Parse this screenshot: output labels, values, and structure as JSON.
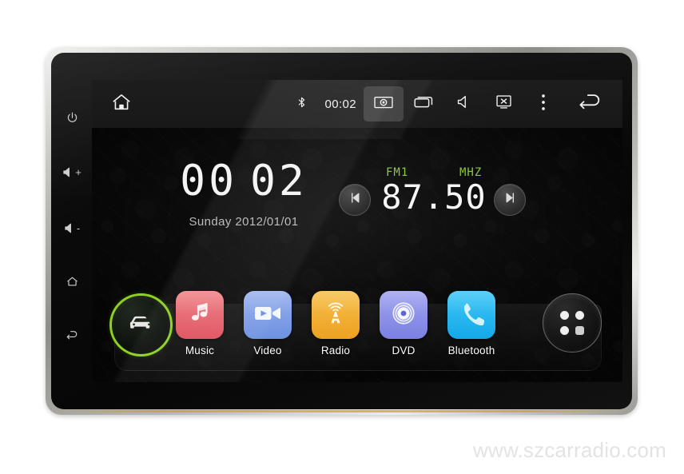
{
  "device": {
    "name": "2-din android car radio head unit",
    "watermark": "www.szcarradio.com"
  },
  "hardware_keys": [
    {
      "name": "power",
      "icon": "power-icon",
      "label": ""
    },
    {
      "name": "volume-up",
      "icon": "volume-up-icon",
      "label": "+"
    },
    {
      "name": "volume-down",
      "icon": "volume-down-icon",
      "label": "-"
    },
    {
      "name": "home",
      "icon": "home-outline-icon",
      "label": ""
    },
    {
      "name": "back",
      "icon": "back-arrow-icon",
      "label": ""
    }
  ],
  "statusbar": {
    "home_icon": "home-icon",
    "bluetooth_icon": "bluetooth-icon",
    "clock": "00:02",
    "screenshot_icon": "screenshot-icon",
    "recents_icon": "recents-icon",
    "volume_icon": "volume-icon",
    "screen_off_icon": "screen-off-icon",
    "overflow_icon": "overflow-menu-icon",
    "back_icon": "back-arrow-icon",
    "active_item": "screenshot"
  },
  "clock_widget": {
    "hours": "00",
    "minutes": "02",
    "date": "Sunday 2012/01/01"
  },
  "radio_widget": {
    "band": "FM1",
    "unit": "MHZ",
    "frequency": "87.50",
    "accent_color": "#8cc63f",
    "prev_icon": "skip-previous-icon",
    "next_icon": "skip-next-icon"
  },
  "dock": {
    "car_button": {
      "label": "",
      "icon": "car-icon",
      "ring_color": "#8ed122"
    },
    "apps": [
      {
        "label": "Music",
        "icon": "music-note-icon",
        "color": "#e8616b"
      },
      {
        "label": "Video",
        "icon": "video-camera-icon",
        "color": "#7e9fe8"
      },
      {
        "label": "Radio",
        "icon": "radio-tower-icon",
        "color": "#f2b02c"
      },
      {
        "label": "DVD",
        "icon": "disc-icon",
        "color": "#8a8fe8"
      },
      {
        "label": "Bluetooth",
        "icon": "phone-icon",
        "color": "#27b7f0"
      }
    ],
    "drawer_button": {
      "icon": "app-drawer-icon"
    }
  }
}
